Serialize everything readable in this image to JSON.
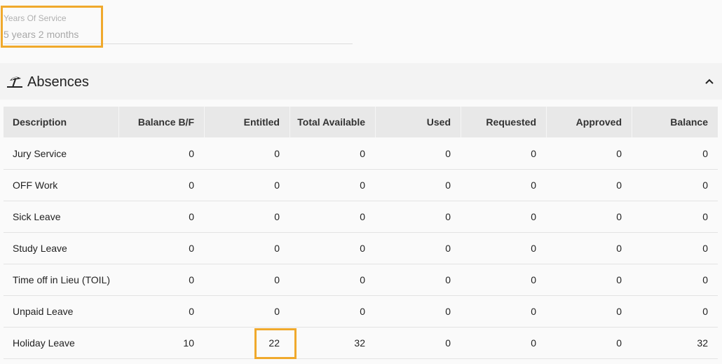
{
  "years_of_service": {
    "label": "Years Of Service",
    "value": "5 years 2 months"
  },
  "absences": {
    "title": "Absences",
    "icon": "beach-umbrella-icon",
    "collapse_icon": "chevron-up-icon",
    "columns": [
      "Description",
      "Balance B/F",
      "Entitled",
      "Total Available",
      "Used",
      "Requested",
      "Approved",
      "Balance"
    ],
    "rows": [
      [
        "Jury Service",
        "0",
        "0",
        "0",
        "0",
        "0",
        "0",
        "0"
      ],
      [
        "OFF Work",
        "0",
        "0",
        "0",
        "0",
        "0",
        "0",
        "0"
      ],
      [
        "Sick Leave",
        "0",
        "0",
        "0",
        "0",
        "0",
        "0",
        "0"
      ],
      [
        "Study Leave",
        "0",
        "0",
        "0",
        "0",
        "0",
        "0",
        "0"
      ],
      [
        "Time off in Lieu (TOIL)",
        "0",
        "0",
        "0",
        "0",
        "0",
        "0",
        "0"
      ],
      [
        "Unpaid Leave",
        "0",
        "0",
        "0",
        "0",
        "0",
        "0",
        "0"
      ],
      [
        "Holiday Leave",
        "10",
        "22",
        "32",
        "0",
        "0",
        "0",
        "32"
      ]
    ]
  },
  "highlight_color": "#f0a92c"
}
